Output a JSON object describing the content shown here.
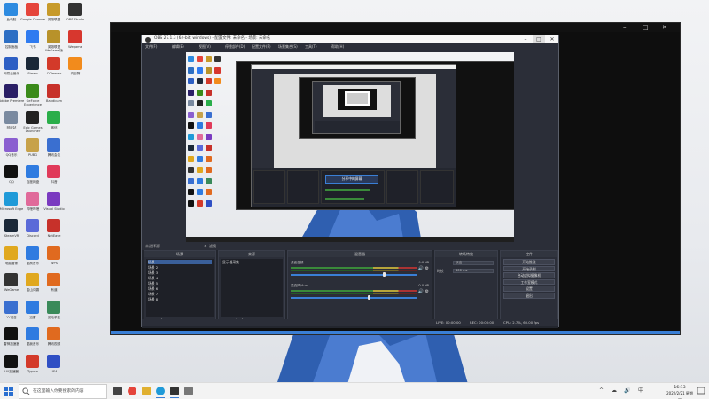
{
  "desktop": {
    "icons": [
      {
        "label": "此电脑",
        "color": "#2e8be0"
      },
      {
        "label": "Google Chrome",
        "color": "#e5453b"
      },
      {
        "label": "英雄联盟",
        "color": "#c79a2a"
      },
      {
        "label": "OBS Studio",
        "color": "#333333"
      },
      {
        "label": "控制面板",
        "color": "#2d6fc4"
      },
      {
        "label": "飞书",
        "color": "#2f7bf0"
      },
      {
        "label": "英雄联盟 WeGame版",
        "color": "#b8922a"
      },
      {
        "label": "Wegame",
        "color": "#d7372e"
      },
      {
        "label": "网易云音乐",
        "color": "#2d5fc4"
      },
      {
        "label": "Steam",
        "color": "#1b2838"
      },
      {
        "label": "CCleaner",
        "color": "#d33a2a"
      },
      {
        "label": "向日葵",
        "color": "#f28b1c"
      },
      {
        "label": "Adobe Premiere",
        "color": "#2a1f66"
      },
      {
        "label": "GeForce Experience",
        "color": "#3a8a1a"
      },
      {
        "label": "Bandicam",
        "color": "#c7312a"
      },
      {
        "label": "",
        "color": "#ffffff"
      },
      {
        "label": "回收站",
        "color": "#7a8aa0"
      },
      {
        "label": "Epic Games Launcher",
        "color": "#222222"
      },
      {
        "label": "微信",
        "color": "#2aae4a"
      },
      {
        "label": "",
        "color": "#ffffff"
      },
      {
        "label": "QQ音乐",
        "color": "#8a5fd0"
      },
      {
        "label": "PUBG",
        "color": "#c7a24a"
      },
      {
        "label": "腾讯会议",
        "color": "#3a6fd0"
      },
      {
        "label": "",
        "color": "#ffffff"
      },
      {
        "label": "QQ",
        "color": "#111111"
      },
      {
        "label": "百度网盘",
        "color": "#2f7be0"
      },
      {
        "label": "抖音",
        "color": "#e03a5a"
      },
      {
        "label": "",
        "color": "#ffffff"
      },
      {
        "label": "Microsoft Edge",
        "color": "#1f9ad8"
      },
      {
        "label": "哔哩哔哩",
        "color": "#e06a9a"
      },
      {
        "label": "Visual Studio",
        "color": "#7a3ac0"
      },
      {
        "label": "",
        "color": "#ffffff"
      },
      {
        "label": "SteamVR",
        "color": "#1b2838"
      },
      {
        "label": "Discord",
        "color": "#5a6ad8"
      },
      {
        "label": "NetEase",
        "color": "#c7312a"
      },
      {
        "label": "",
        "color": "#ffffff"
      },
      {
        "label": "电脑管家",
        "color": "#e0a81f"
      },
      {
        "label": "酷狗音乐",
        "color": "#2f7be0"
      },
      {
        "label": "WPS",
        "color": "#e06a1f"
      },
      {
        "label": "",
        "color": "#ffffff"
      },
      {
        "label": "WeGame",
        "color": "#333333"
      },
      {
        "label": "金山词霸",
        "color": "#e0a81f"
      },
      {
        "label": "有道",
        "color": "#e06a1f"
      },
      {
        "label": "",
        "color": "#ffffff"
      },
      {
        "label": "YY语音",
        "color": "#3a6fd0"
      },
      {
        "label": "迅雷",
        "color": "#2f7be0"
      },
      {
        "label": "绝地求生",
        "color": "#3a8a5a"
      },
      {
        "label": "",
        "color": "#ffffff"
      },
      {
        "label": "雷神加速器",
        "color": "#111111"
      },
      {
        "label": "酷我音乐",
        "color": "#2f7be0"
      },
      {
        "label": "腾讯视频",
        "color": "#e06a1f"
      },
      {
        "label": "",
        "color": "#ffffff"
      },
      {
        "label": "UU加速器",
        "color": "#111111"
      },
      {
        "label": "Typora",
        "color": "#d33a2a"
      },
      {
        "label": "UE4",
        "color": "#2f4fc4"
      }
    ]
  },
  "projector": {
    "controls": {
      "minimize": "–",
      "maximize": "□",
      "close": "✕"
    },
    "accent": "#3a7fd6"
  },
  "obs": {
    "title": "OBS 27.1.3 (64-bit, windows) - 配置文件: 未命名 - 场景: 未命名",
    "window_controls": {
      "minimize": "–",
      "maximize": "□",
      "close": "✕"
    },
    "menu": [
      "文件(F)",
      "编辑(E)",
      "视图(V)",
      "停靠部件(D)",
      "配置文件(P)",
      "场景集合(S)",
      "工具(T)",
      "帮助(H)"
    ],
    "preview_toolbar": {
      "source_label": "未选择源",
      "props_icon": "gear-icon",
      "filter_label": "滤镜"
    },
    "docks": {
      "scenes": {
        "title": "场景",
        "items": [
          "场景",
          "场景 2",
          "场景 3",
          "场景 4",
          "场景 5",
          "场景 6",
          "场景 7",
          "场景 8"
        ]
      },
      "sources": {
        "title": "来源",
        "items": [
          "显示器采集"
        ]
      },
      "mixer": {
        "title": "混音器",
        "tracks": [
          {
            "name": "桌面音频",
            "db": "0.0 dB",
            "level": 0.72
          },
          {
            "name": "麦克风/Aux",
            "db": "0.0 dB",
            "level": 0.6
          }
        ]
      },
      "transitions": {
        "title": "转场特效",
        "type_label": "淡出",
        "duration_label": "时长",
        "duration_value": "300 ms"
      },
      "controls": {
        "title": "控件",
        "buttons": [
          "开始推流",
          "开始录制",
          "启动虚拟摄像机",
          "工作室模式",
          "设置",
          "退出"
        ]
      }
    },
    "status": {
      "live": "LIVE: 00:00:00",
      "rec": "REC: 00:00:00",
      "cpu": "CPU: 2.7%, 60.00 fps"
    },
    "preview_overlay_text": "分享中的屏幕"
  },
  "taskbar": {
    "search_placeholder": "在这里输入你要搜索的内容",
    "apps": [
      {
        "name": "task-view",
        "color": "#444444",
        "active": false
      },
      {
        "name": "chrome",
        "color": "#e5453b",
        "active": false
      },
      {
        "name": "file-explorer",
        "color": "#e0b030",
        "active": false
      },
      {
        "name": "edge",
        "color": "#1f9ad8",
        "active": true
      },
      {
        "name": "obs",
        "color": "#333333",
        "active": true
      },
      {
        "name": "notepad",
        "color": "#777777",
        "active": false
      }
    ],
    "tray": [
      "^",
      "☁",
      "🔊",
      "中"
    ],
    "time": "16:13",
    "date": "2022/2/21 星期一"
  }
}
